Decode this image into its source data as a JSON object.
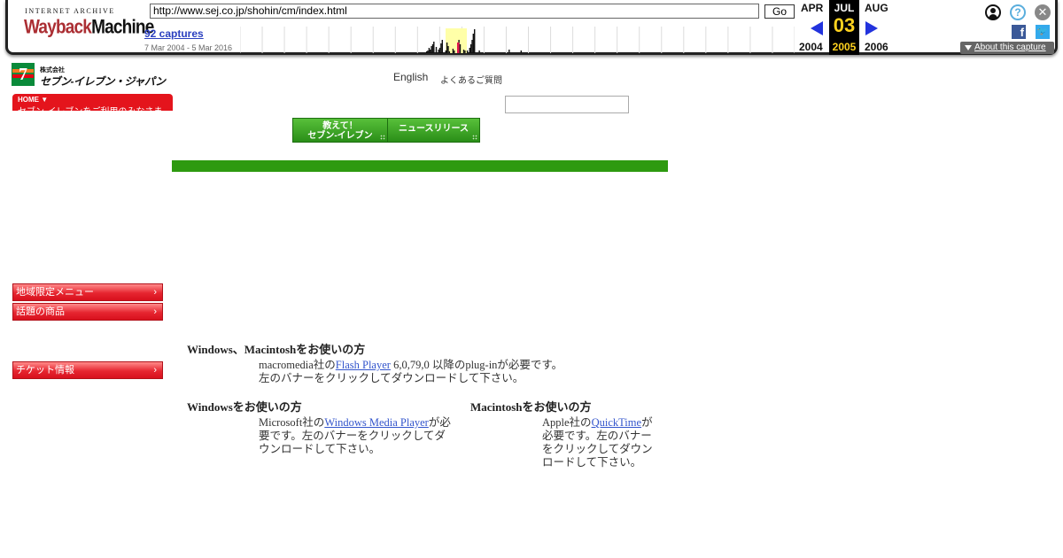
{
  "wayback": {
    "logo_top": "INTERNET ARCHIVE",
    "logo_word1": "Wayback",
    "logo_word2": "Machine",
    "url": "http://www.sej.co.jp/shohin/cm/index.html",
    "go_label": "Go",
    "captures_label": "92 captures",
    "date_range": "7 Mar 2004 - 5 Mar 2016",
    "prev_month": "APR",
    "prev_year": "2004",
    "current_month": "JUL",
    "current_day": "03",
    "current_year": "2005",
    "next_month": "AUG",
    "next_year": "2006",
    "about_label": "About this capture",
    "sparkline_heights": [
      0,
      0,
      0,
      0,
      0,
      0,
      0,
      0,
      0,
      0,
      0,
      0,
      0,
      0,
      0,
      0,
      0,
      0,
      0,
      0,
      0,
      0,
      0,
      0,
      0,
      0,
      0,
      0,
      0,
      0,
      0,
      0,
      0,
      0,
      0,
      0,
      0,
      0,
      0,
      0,
      0,
      0,
      0,
      0,
      0,
      0,
      0,
      0,
      0,
      0,
      0,
      0,
      0,
      0,
      0,
      0,
      0,
      0,
      0,
      0,
      0,
      0,
      0,
      0,
      0,
      0,
      0,
      0,
      0,
      0,
      0,
      0,
      0,
      0,
      0,
      0,
      0,
      0,
      0,
      0,
      2,
      3,
      6,
      4,
      8,
      10,
      13,
      0,
      7,
      0,
      4,
      6,
      11,
      15,
      0,
      0,
      3,
      12,
      8,
      2,
      0,
      0,
      5,
      3,
      0,
      0,
      8,
      15,
      10,
      0,
      0,
      4,
      3,
      0,
      3,
      0,
      6,
      10,
      15,
      22,
      27,
      0,
      0,
      0,
      3,
      0,
      0,
      0,
      0,
      0,
      0,
      0,
      0,
      0,
      0,
      0,
      0,
      0,
      0,
      0,
      0,
      0,
      0,
      0,
      0,
      0,
      0,
      0,
      0,
      4,
      0,
      0,
      0,
      0,
      0,
      0,
      0,
      0,
      0,
      3,
      0,
      0,
      0,
      0,
      0,
      0,
      0,
      0,
      0,
      0,
      0,
      0,
      0,
      0,
      0,
      0,
      0,
      0,
      0,
      0,
      0,
      0,
      0,
      0,
      0,
      0,
      0,
      0,
      0,
      0,
      0,
      0,
      0,
      0,
      0,
      0,
      0,
      0,
      0,
      0,
      0,
      0,
      0,
      0,
      0,
      0,
      0,
      0,
      0,
      0,
      0,
      0,
      0,
      0,
      0,
      0,
      0,
      0,
      0,
      0,
      0,
      0,
      0,
      0,
      0,
      0,
      0,
      0,
      0,
      0,
      0,
      0,
      0,
      0,
      0,
      0,
      0,
      0,
      0,
      0,
      0,
      0,
      0,
      0,
      0,
      0,
      0,
      0,
      0,
      0,
      0,
      0,
      0,
      0,
      0,
      0,
      0,
      0,
      0,
      0,
      0,
      0,
      0,
      0,
      0,
      0,
      0,
      0,
      0,
      0,
      0,
      0,
      0,
      0,
      0,
      0,
      0,
      0,
      0,
      0,
      0,
      0,
      0,
      0,
      0,
      0,
      0,
      0,
      0,
      0,
      0,
      0,
      0,
      0,
      0,
      0,
      0,
      0,
      0,
      0,
      0,
      0,
      0,
      0,
      0,
      0,
      0,
      0,
      0,
      0,
      0,
      0,
      0,
      0,
      0,
      0,
      0,
      0,
      0,
      0,
      0,
      0,
      0,
      0,
      0,
      0,
      0,
      0,
      0,
      0,
      0,
      0,
      0,
      0,
      0,
      0,
      0,
      0,
      0,
      0,
      0,
      0,
      0,
      0,
      0,
      0,
      0,
      0,
      0,
      0,
      0,
      0,
      0,
      0,
      0,
      0,
      0,
      0,
      0,
      0,
      0,
      0,
      0,
      0,
      0,
      0,
      0,
      0,
      0,
      0,
      0,
      0,
      0,
      0,
      0,
      0,
      0,
      0,
      0,
      0,
      0,
      0,
      0,
      0,
      0,
      0,
      0,
      0,
      0,
      0,
      0,
      0,
      0,
      0,
      0,
      0,
      0,
      0,
      0,
      0,
      0,
      0,
      0,
      0,
      0,
      0,
      0,
      0,
      0,
      0,
      0,
      0,
      0,
      0,
      0,
      0,
      0,
      0,
      0,
      0,
      0,
      0,
      0,
      0,
      0,
      0,
      0,
      0,
      0,
      0,
      0,
      0,
      0,
      0,
      0,
      0,
      0,
      0,
      0,
      0,
      0,
      0,
      0,
      0,
      0,
      0,
      0,
      0,
      0,
      0,
      0,
      0,
      0,
      0,
      0,
      0,
      0,
      0,
      0,
      0,
      0,
      0,
      0,
      0,
      0,
      0,
      0,
      0,
      0,
      0,
      0,
      0,
      0,
      0,
      0,
      0,
      0,
      0,
      0,
      0,
      0,
      0,
      0,
      0,
      0,
      0,
      0,
      0,
      0,
      0,
      0,
      0,
      0,
      0,
      0,
      0,
      0,
      0,
      0,
      0,
      0,
      0,
      0,
      0,
      0,
      0,
      0,
      0,
      0,
      0,
      0,
      0,
      0,
      0,
      0,
      0,
      0,
      0,
      0,
      0,
      0,
      0,
      0,
      0,
      0,
      0,
      0,
      0,
      0,
      0,
      0,
      0,
      0,
      0,
      0,
      0,
      0,
      0,
      0,
      0,
      0,
      0,
      0,
      0,
      0,
      0,
      0,
      0,
      0,
      0,
      0,
      0,
      0,
      0,
      0,
      0,
      0,
      0,
      0,
      0,
      0,
      0,
      0,
      0,
      0,
      0,
      0,
      0,
      0,
      0,
      0,
      0,
      0,
      0,
      0,
      0,
      0,
      0,
      0,
      0,
      0,
      0,
      0,
      0,
      0,
      0,
      0,
      0,
      0,
      0,
      0,
      0,
      0,
      0,
      0,
      0,
      0,
      0,
      0,
      0,
      0,
      0,
      0,
      0,
      0,
      0,
      0,
      0,
      0,
      0,
      0,
      0,
      0,
      0,
      0,
      0,
      0,
      0,
      0,
      0,
      0,
      0,
      0,
      0,
      0,
      0,
      0,
      0,
      0,
      0,
      0,
      0,
      0,
      0,
      0,
      0,
      0,
      0,
      0,
      0,
      0,
      0,
      0,
      0,
      0,
      0,
      0,
      0,
      0,
      0,
      0,
      0,
      0,
      0,
      0,
      0,
      0,
      0,
      0,
      0,
      0,
      0,
      0,
      0,
      0,
      0,
      0,
      0,
      0,
      0,
      0,
      0,
      0,
      0,
      0,
      0,
      0,
      0,
      0,
      0,
      0,
      0,
      0,
      0,
      0,
      0,
      0,
      0,
      0,
      0,
      0,
      0,
      0,
      0,
      0,
      0,
      0,
      0,
      0,
      0,
      0,
      0,
      0,
      0,
      0,
      0,
      0,
      0,
      0,
      0
    ],
    "colors": {
      "accent_blue": "#2233dd",
      "highlight": "#ffffa8",
      "current_marker": "#e0144c"
    }
  },
  "site": {
    "corp_small": "株式会社",
    "corp_name": "セブン-イレブン・ジャパン",
    "english_link": "English",
    "faq_link": "よくあるご質問",
    "home_label": "HOME ▼",
    "home_sub": "セブン-イレブンをご利用のみなさま",
    "nav_btn1": "教えて！\nセブン-イレブン",
    "nav_btn2": "ニュースリリース",
    "side_menu": [
      "地域限定メニュー",
      "話題の商品",
      "チケット情報"
    ],
    "colors": {
      "green": "#2e9a10",
      "red": "#e4141c"
    }
  },
  "content": {
    "win_mac_head": "Windows、Macintoshをお使いの方",
    "win_mac_pre": "macromedia社の",
    "win_mac_link": "Flash Player",
    "win_mac_post": " 6,0,79,0 以降のplug-inが必要です。",
    "win_mac_line2": "左のバナーをクリックしてダウンロードして下さい。",
    "win_head": "Windowsをお使いの方",
    "win_pre": "Microsoft社の",
    "win_link": "Windows Media Player",
    "win_post": "が必要です。左のバナーをクリックしてダウンロードして下さい。",
    "mac_head": "Macintoshをお使いの方",
    "mac_pre": "Apple社の",
    "mac_link": "QuickTime",
    "mac_post": "が必要です。左のバナーをクリックしてダウンロードして下さい。"
  }
}
